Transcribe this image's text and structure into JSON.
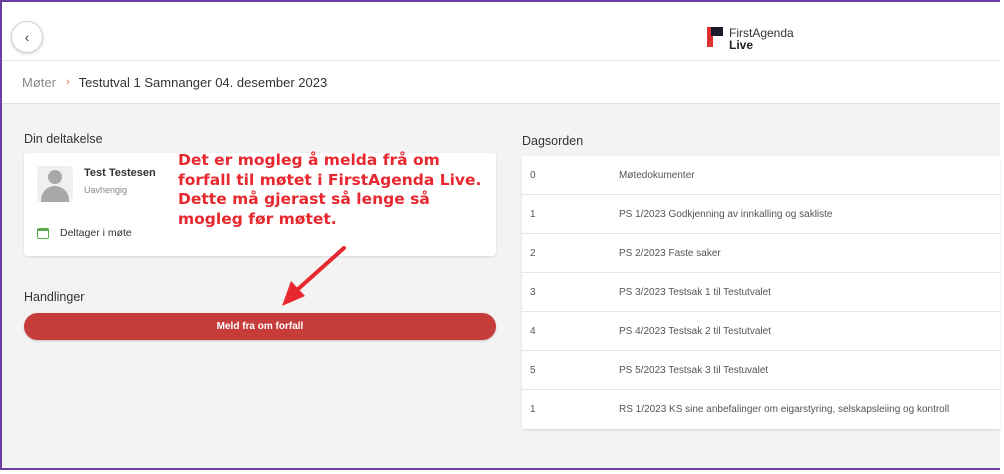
{
  "header": {
    "back_icon": "chevron-left-icon",
    "back_glyph": "‹",
    "logo_name": "FirstAgenda",
    "logo_sub": "Live"
  },
  "breadcrumb": {
    "root": "Møter",
    "separator": "›",
    "current": "Testutval 1 Samnanger 04. desember 2023"
  },
  "participation": {
    "title": "Din deltakelse",
    "name": "Test Testesen",
    "role": "Uavhengig",
    "status": "Deltager i møte"
  },
  "callout_lines": [
    "Det er mogleg å melda frå om",
    "forfall til møtet i FirstAgenda Live.",
    "Dette må gjerast så lenge så",
    "mogleg før møtet."
  ],
  "actions": {
    "title": "Handlinger",
    "button_label": "Meld fra om forfall"
  },
  "agenda": {
    "title": "Dagsorden",
    "items": [
      {
        "num": "0",
        "title": "Møtedokumenter"
      },
      {
        "num": "1",
        "title": "PS 1/2023 Godkjenning av innkalling og sakliste"
      },
      {
        "num": "2",
        "title": "PS 2/2023 Faste saker"
      },
      {
        "num": "3",
        "title": "PS 3/2023 Testsak 1 til Testutvalet"
      },
      {
        "num": "4",
        "title": "PS 4/2023 Testsak 2 til Testutvalet"
      },
      {
        "num": "5",
        "title": "PS 5/2023 Testsak 3 til Testuvalet"
      },
      {
        "num": "1",
        "title": "RS 1/2023 KS sine anbefalinger om eigarstyring, selskapsleiing og kontroll"
      }
    ]
  },
  "colors": {
    "accent_red": "#c63c3a",
    "callout_red": "#e8282f",
    "frame_purple": "#6b3fa0",
    "status_green": "#5aaa4a"
  }
}
